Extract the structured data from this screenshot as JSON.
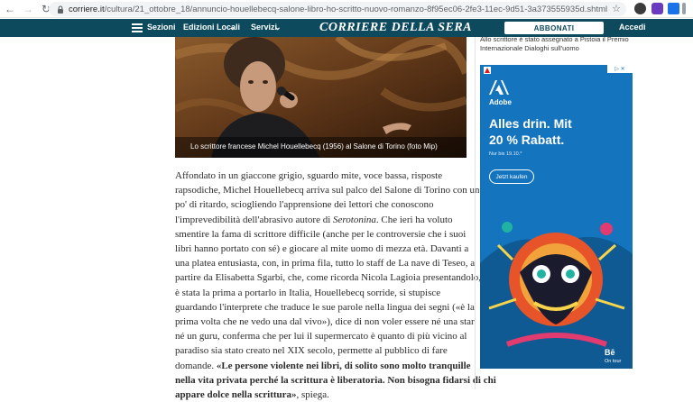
{
  "browser": {
    "url_host": "corriere.it",
    "url_path": "/cultura/21_ottobre_18/annuncio-houellebecq-salone-libro-ho-scritto-nuovo-romanzo-8f95ec06-2fe3-11ec-9d51-3a373555935d.shtml"
  },
  "header": {
    "menu_label": "Sezioni",
    "edizioni_label": "Edizioni Locali",
    "servizi_label": "Servizi",
    "logo_text": "CORRIERE DELLA SERA",
    "subscribe_label": "ABBONATI",
    "login_label": "Accedi"
  },
  "photo": {
    "caption": "Lo scrittore francese Michel Houellebecq (1956) al Salone di Torino (foto Mip)"
  },
  "article": {
    "lines": [
      "Affondato in un giaccone grigio, sguardo mite, voce bassa, risposte",
      "rapsodiche, Michel Houellebecq arriva sul palco del Salone di Torino con un",
      "po' di ritardo, sciogliendo l'apprensione dei lettori che conoscono",
      "l'imprevedibilità dell'abrasivo autore di ",
      "smentire la fama di scrittore difficile (anche per le controversie che i suoi",
      "libri hanno portato con sé) e giocare al mite uomo di mezza età. Davanti a",
      "una platea entusiasta, con, in prima fila, tutto lo staff de La nave di Teseo, a",
      "partire da Elisabetta Sgarbi, che, come ricorda Nicola Lagioia presentandolo,",
      "è stata la prima a portarlo in Italia, Houellebecq sorride, si stupisce",
      "guardando l'interprete che traduce le sue parole nella lingua dei segni («è la",
      "prima volta che ne vedo una dal vivo»), dice di non voler essere né una star",
      "né un guru, conferma che per lui il supermercato è quanto di più vicino al",
      "paradiso sia stato creato nel XIX secolo, permette al pubblico di fare",
      "domande. ",
      "nella vita privata perché la scrittura è liberatoria. Non bisogna fidarsi di chi",
      "appare dolce nella scrittura»",
      ", spiega."
    ],
    "italic_title": "Serotonina",
    "line4_tail": ". Che ieri ha voluto",
    "quote_start": "«Le persone violente nei libri, di solito sono molto tranquille"
  },
  "sidebar": {
    "text_line1": "Allo scrittore è stato assegnato a Pistoia il Premio",
    "text_line2": "Internazionale Dialoghi sull'uomo"
  },
  "ad": {
    "brand": "Adobe",
    "headline_1": "Alles drin. Mit",
    "headline_2": "20 % Rabatt.",
    "small": "Nur bis 19.10.*",
    "cta": "Jetzt kaufen",
    "behance": "Bē",
    "behance_sub": "On tour",
    "colors": {
      "bg": "#1474bd"
    }
  }
}
